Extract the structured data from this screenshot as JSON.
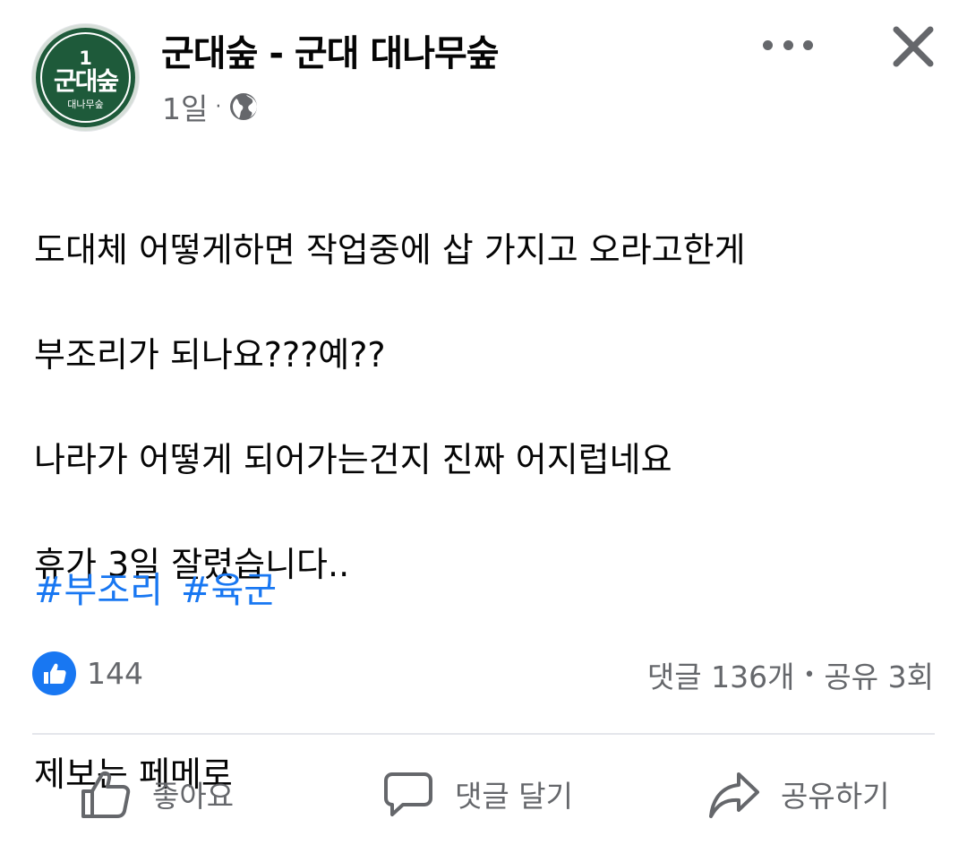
{
  "post": {
    "page_name": "군대숲 - 군대 대나무숲",
    "avatar": {
      "number": "1",
      "brand": "군대숲",
      "sub": "대나무숲"
    },
    "time": "1일",
    "separator": "·",
    "body_lines": [
      "도대체 어떻게하면 작업중에 삽 가지고 오라고한게",
      "부조리가 되나요???예??",
      "나라가 어떻게 되어가는건지 진짜 어지럽네요",
      "휴가 3일 잘렸습니다..",
      "",
      "제보는 페메로"
    ],
    "hashtags": [
      "#부조리",
      "#육군"
    ]
  },
  "engagement": {
    "like_count": "144",
    "comments": "댓글 136개",
    "separator": "•",
    "shares": "공유 3회"
  },
  "actions": {
    "like_label": "좋아요",
    "comment_label": "댓글 달기",
    "share_label": "공유하기"
  },
  "colors": {
    "accent": "#1877f2",
    "secondary_text": "#65676b",
    "avatar_green": "#1e5a3a"
  },
  "icons": [
    "globe-icon",
    "more-icon",
    "close-icon",
    "thumbs-up-icon",
    "comment-icon",
    "share-icon"
  ]
}
